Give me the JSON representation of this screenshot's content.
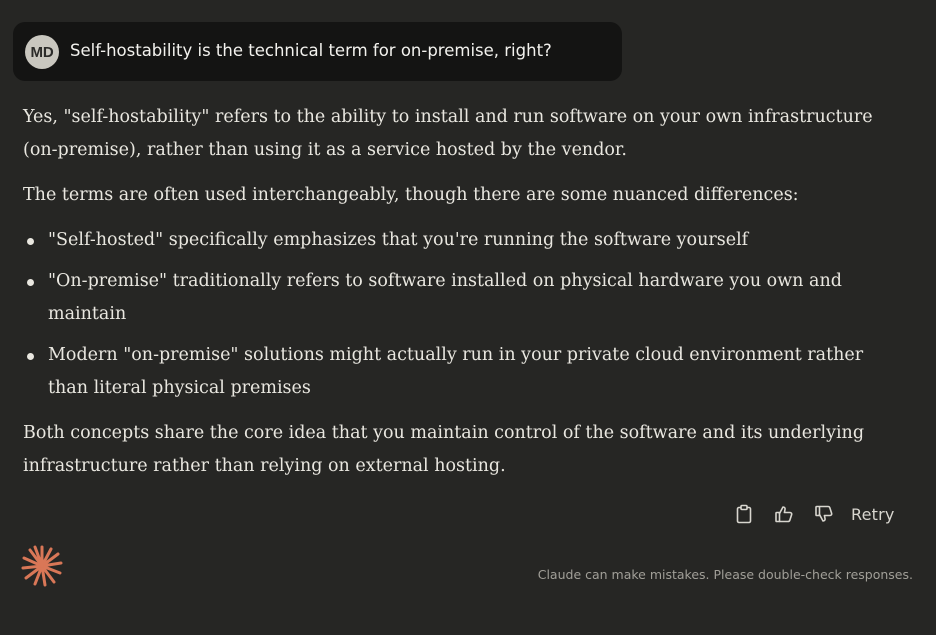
{
  "user_message": {
    "avatar_initials": "MD",
    "text": "Self-hostability is the technical term for on-premise, right?"
  },
  "response": {
    "paragraph_1": "Yes, \"self-hostability\" refers to the ability to install and run software on your own infrastructure (on-premise), rather than using it as a service hosted by the vendor.",
    "paragraph_2": "The terms are often used interchangeably, though there are some nuanced differences:",
    "bullets": [
      "\"Self-hosted\" specifically emphasizes that you're running the software yourself",
      "\"On-premise\" traditionally refers to software installed on physical hardware you own and maintain",
      "Modern \"on-premise\" solutions might actually run in your private cloud environment rather than literal physical premises"
    ],
    "paragraph_3": "Both concepts share the core idea that you maintain control of the software and its underlying infrastructure rather than relying on external hosting."
  },
  "actions": {
    "copy_icon": "clipboard-icon",
    "thumbs_up_icon": "thumbs-up-icon",
    "thumbs_down_icon": "thumbs-down-icon",
    "retry_label": "Retry"
  },
  "footer": {
    "logo_icon": "claude-starburst-icon",
    "disclaimer": "Claude can make mistakes. Please double-check responses."
  },
  "colors": {
    "background": "#262624",
    "user_bubble": "#141413",
    "accent_logo": "#d97757",
    "text": "#e9e7e0",
    "muted_text": "#a19f98"
  }
}
